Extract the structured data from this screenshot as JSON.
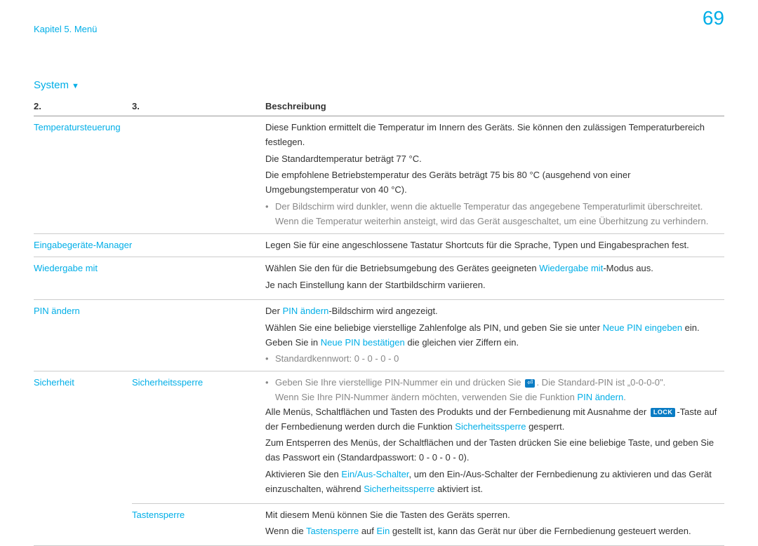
{
  "page_number": "69",
  "chapter": "Kapitel 5. Menü",
  "section_title": "System",
  "headers": {
    "c1": "2.",
    "c2": "3.",
    "c3": "Beschreibung"
  },
  "rows": {
    "temp": {
      "label": "Temperatursteuerung",
      "p1": "Diese Funktion ermittelt die Temperatur im Innern des Geräts. Sie können den zulässigen Temperaturbereich festlegen.",
      "p2": "Die Standardtemperatur beträgt 77 °C.",
      "p3": "Die empfohlene Betriebstemperatur des Geräts beträgt 75 bis 80 °C (ausgehend von einer Umgebungstemperatur von 40 °C).",
      "b1": "Der Bildschirm wird dunkler, wenn die aktuelle Temperatur das angegebene Temperaturlimit überschreitet. Wenn die Temperatur weiterhin ansteigt, wird das Gerät ausgeschaltet, um eine Überhitzung zu verhindern."
    },
    "input": {
      "label": "Eingabegeräte-Manager",
      "p1": "Legen Sie für eine angeschlossene Tastatur Shortcuts für die Sprache, Typen und Eingabesprachen fest."
    },
    "playwith": {
      "label": "Wiedergabe mit",
      "pre": "Wählen Sie den für die Betriebsumgebung des Gerätes geeigneten ",
      "link": "Wiedergabe mit",
      "post": "-Modus aus.",
      "p2": "Je nach Einstellung kann der Startbildschirm variieren."
    },
    "pin": {
      "label": "PIN ändern",
      "pre": "Der ",
      "link": "PIN ändern",
      "post": "-Bildschirm wird angezeigt.",
      "p2a": "Wählen Sie eine beliebige vierstellige Zahlenfolge als PIN, und geben Sie sie unter ",
      "p2link1": "Neue PIN eingeben",
      "p2b": " ein. Geben Sie in ",
      "p2link2": "Neue PIN bestätigen",
      "p2c": " die gleichen vier Ziffern ein.",
      "b1": "Standardkennwort: 0 - 0 - 0 - 0"
    },
    "sec": {
      "label": "Sicherheit",
      "lock": {
        "label": "Sicherheitssperre",
        "b1a": "Geben Sie Ihre vierstellige PIN-Nummer ein und drücken Sie ",
        "b1icon": "⏎",
        "b1b": ". Die Standard-PIN ist „0-0-0-0\".",
        "b1c": "Wenn Sie Ihre PIN-Nummer ändern möchten, verwenden Sie die Funktion ",
        "b1link": "PIN ändern",
        "b1d": ".",
        "p2a": "Alle Menüs, Schaltflächen und Tasten des Produkts und der Fernbedienung mit Ausnahme der ",
        "lockbtn": "LOCK",
        "p2b": "-Taste auf der Fernbedienung werden durch die Funktion ",
        "p2link": "Sicherheitssperre",
        "p2c": " gesperrt.",
        "p3": "Zum Entsperren des Menüs, der Schaltflächen und der Tasten drücken Sie eine beliebige Taste, und geben Sie das Passwort ein (Standardpasswort: 0 - 0 - 0 - 0).",
        "p4a": "Aktivieren Sie den ",
        "p4link1": "Ein/Aus-Schalter",
        "p4b": ", um den Ein-/Aus-Schalter der Fernbedienung zu aktivieren und das Gerät einzuschalten, während ",
        "p4link2": "Sicherheitssperre",
        "p4c": " aktiviert ist."
      },
      "btnlock": {
        "label": "Tastensperre",
        "p1": "Mit diesem Menü können Sie die Tasten des Geräts sperren.",
        "p2a": "Wenn die ",
        "p2link1": "Tastensperre",
        "p2b": " auf ",
        "p2link2": "Ein",
        "p2c": " gestellt ist, kann das Gerät nur über die Fernbedienung gesteuert werden."
      }
    }
  }
}
